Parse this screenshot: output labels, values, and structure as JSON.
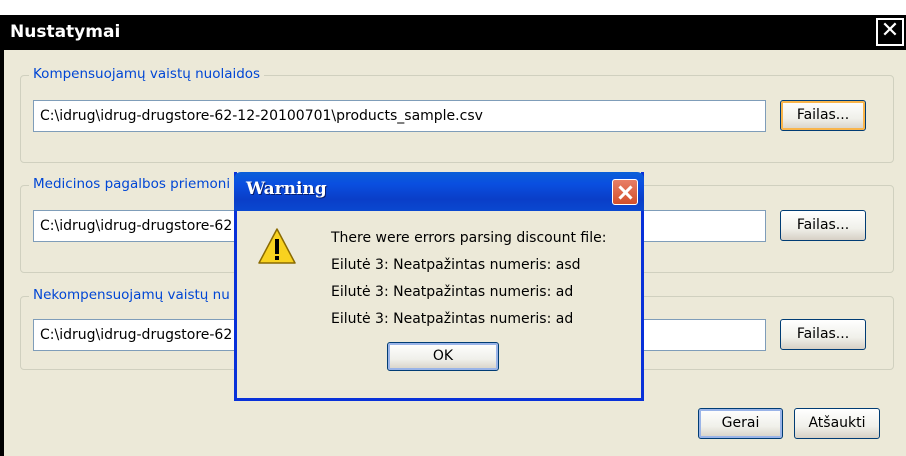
{
  "window": {
    "title": "Nustatymai",
    "close_glyph": "✕"
  },
  "groups": [
    {
      "label": "Kompensuojamų vaistų nuolaidos",
      "path": "C:\\idrug\\idrug-drugstore-62-12-20100701\\products_sample.csv",
      "button": "Failas..."
    },
    {
      "label": "Medicinos pagalbos priemoni",
      "path": "C:\\idrug\\idrug-drugstore-62",
      "button": "Failas..."
    },
    {
      "label": "Nekompensuojamų vaistų nu",
      "path": "C:\\idrug\\idrug-drugstore-62",
      "button": "Failas..."
    }
  ],
  "footer": {
    "ok_label": "Gerai",
    "cancel_label": "Atšaukti"
  },
  "warning": {
    "title": "Warning",
    "icon": "warning-triangle-icon",
    "lines": [
      "There were errors parsing discount file:",
      "Eilutė 3: Neatpažintas numeris: asd",
      "Eilutė 3: Neatpažintas numeris: ad",
      "Eilutė 3: Neatpažintas numeris: ad"
    ],
    "ok_label": "OK"
  },
  "colors": {
    "group_label": "#0046d5",
    "dialog_frame": "#0831d9",
    "window_bg": "#ece9d8"
  }
}
